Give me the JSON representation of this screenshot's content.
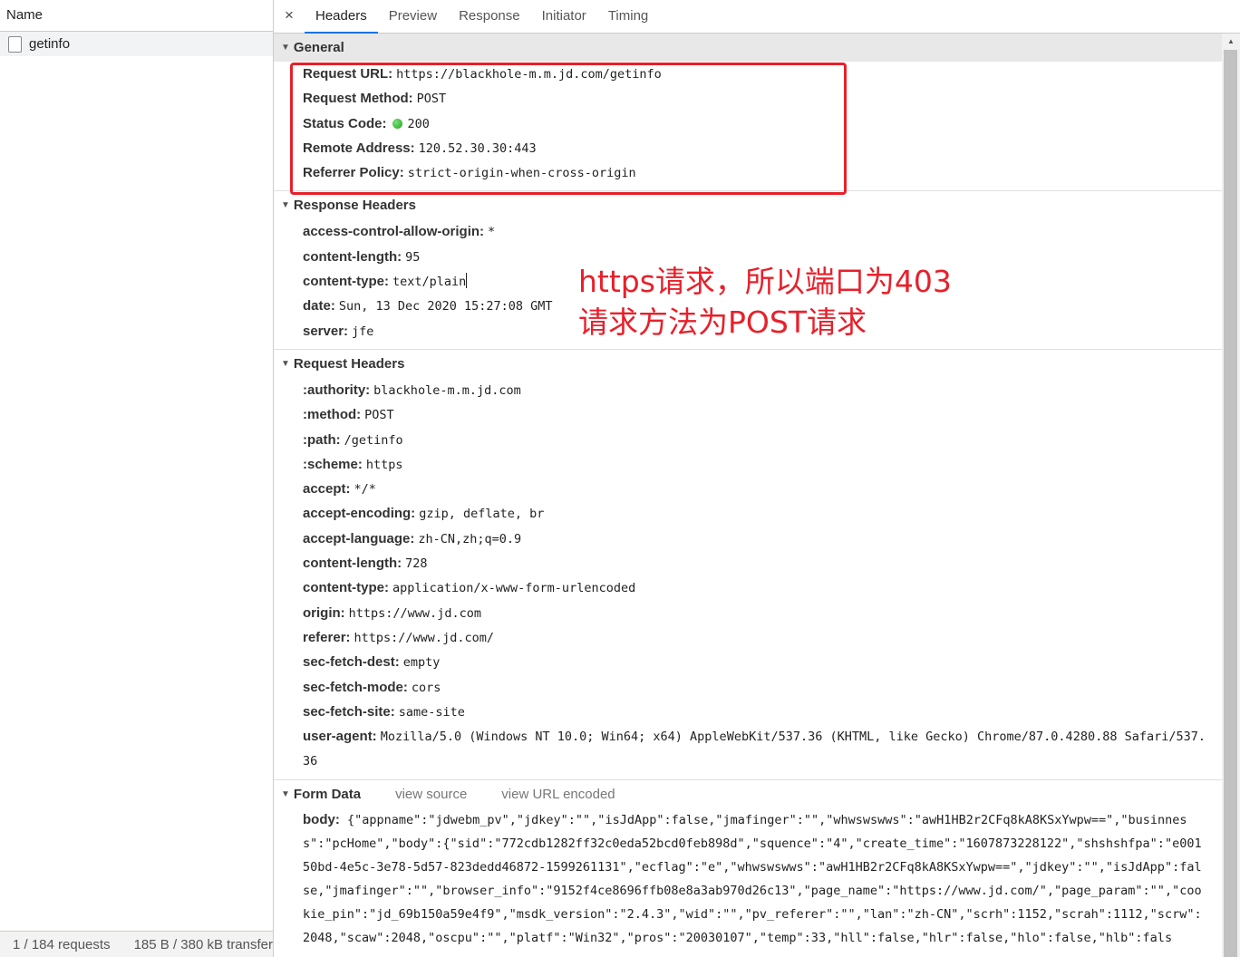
{
  "left": {
    "column": "Name",
    "rows": [
      "getinfo"
    ],
    "status": [
      "1 / 184 requests",
      "185 B / 380 kB transferr"
    ]
  },
  "tabs": [
    "Headers",
    "Preview",
    "Response",
    "Initiator",
    "Timing"
  ],
  "close_glyph": "×",
  "general": {
    "title": "General",
    "items": [
      {
        "k": "Request URL:",
        "v": "https://blackhole-m.m.jd.com/getinfo"
      },
      {
        "k": "Request Method:",
        "v": "POST"
      },
      {
        "k": "Status Code:",
        "v": "200"
      },
      {
        "k": "Remote Address:",
        "v": "120.52.30.30:443"
      },
      {
        "k": "Referrer Policy:",
        "v": "strict-origin-when-cross-origin"
      }
    ]
  },
  "response_headers": {
    "title": "Response Headers",
    "items": [
      {
        "k": "access-control-allow-origin:",
        "v": "*"
      },
      {
        "k": "content-length:",
        "v": "95"
      },
      {
        "k": "content-type:",
        "v": "text/plain"
      },
      {
        "k": "date:",
        "v": "Sun, 13 Dec 2020 15:27:08 GMT"
      },
      {
        "k": "server:",
        "v": "jfe"
      }
    ]
  },
  "request_headers": {
    "title": "Request Headers",
    "items": [
      {
        "k": ":authority:",
        "v": "blackhole-m.m.jd.com"
      },
      {
        "k": ":method:",
        "v": "POST"
      },
      {
        "k": ":path:",
        "v": "/getinfo"
      },
      {
        "k": ":scheme:",
        "v": "https"
      },
      {
        "k": "accept:",
        "v": "*/*"
      },
      {
        "k": "accept-encoding:",
        "v": "gzip, deflate, br"
      },
      {
        "k": "accept-language:",
        "v": "zh-CN,zh;q=0.9"
      },
      {
        "k": "content-length:",
        "v": "728"
      },
      {
        "k": "content-type:",
        "v": "application/x-www-form-urlencoded"
      },
      {
        "k": "origin:",
        "v": "https://www.jd.com"
      },
      {
        "k": "referer:",
        "v": "https://www.jd.com/"
      },
      {
        "k": "sec-fetch-dest:",
        "v": "empty"
      },
      {
        "k": "sec-fetch-mode:",
        "v": "cors"
      },
      {
        "k": "sec-fetch-site:",
        "v": "same-site"
      },
      {
        "k": "user-agent:",
        "v": "Mozilla/5.0 (Windows NT 10.0; Win64; x64) AppleWebKit/537.36 (KHTML, like Gecko) Chrome/87.0.4280.88 Safari/537."
      }
    ],
    "ua_cont": "36"
  },
  "form_data": {
    "title": "Form Data",
    "links": [
      "view source",
      "view URL encoded"
    ],
    "key": "body:",
    "lines": [
      "{\"appname\":\"jdwebm_pv\",\"jdkey\":\"\",\"isJdApp\":false,\"jmafinger\":\"\",\"whwswswws\":\"awH1HB2r2CFq8kA8KSxYwpw==\",\"businnes",
      "s\":\"pcHome\",\"body\":{\"sid\":\"772cdb1282ff32c0eda52bcd0feb898d\",\"squence\":\"4\",\"create_time\":\"1607873228122\",\"shshshfpa\":\"e001",
      "50bd-4e5c-3e78-5d57-823dedd46872-1599261131\",\"ecflag\":\"e\",\"whwswswws\":\"awH1HB2r2CFq8kA8KSxYwpw==\",\"jdkey\":\"\",\"isJdApp\":fal",
      "se,\"jmafinger\":\"\",\"browser_info\":\"9152f4ce8696ffb08e8a3ab970d26c13\",\"page_name\":\"https://www.jd.com/\",\"page_param\":\"\",\"coo",
      "kie_pin\":\"jd_69b150a59e4f9\",\"msdk_version\":\"2.4.3\",\"wid\":\"\",\"pv_referer\":\"\",\"lan\":\"zh-CN\",\"scrh\":1152,\"scrah\":1112,\"scrw\":",
      "2048,\"scaw\":2048,\"oscpu\":\"\",\"platf\":\"Win32\",\"pros\":\"20030107\",\"temp\":33,\"hll\":false,\"hlr\":false,\"hlo\":false,\"hlb\":fals"
    ]
  },
  "annotation": {
    "line1": "https请求，所以端口为403",
    "line2": "请求方法为POST请求",
    "color": "#e8202a"
  }
}
